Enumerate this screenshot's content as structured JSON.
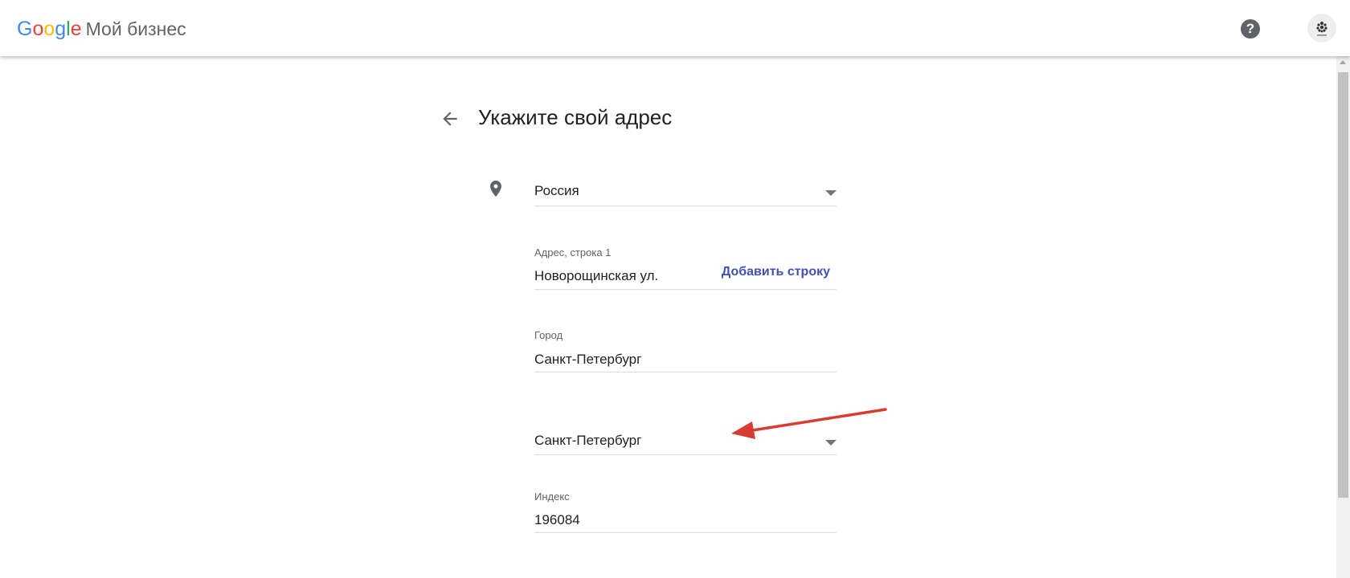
{
  "header": {
    "logo_text": "Google",
    "product_name": "Мой бизнес",
    "help_label": "?"
  },
  "page": {
    "title": "Укажите свой адрес"
  },
  "form": {
    "country": {
      "value": "Россия"
    },
    "address_line1": {
      "label": "Адрес, строка 1",
      "value": "Новорощинская ул.",
      "add_line_label": "Добавить строку"
    },
    "city": {
      "label": "Город",
      "value": "Санкт-Петербург"
    },
    "region": {
      "value": "Санкт-Петербург"
    },
    "postal_code": {
      "label": "Индекс",
      "value": "196084"
    }
  },
  "colors": {
    "google_blue": "#4285F4",
    "google_red": "#EA4335",
    "google_yellow": "#FBBC05",
    "google_green": "#34A853",
    "link_color": "#3F51B5",
    "annotation_arrow": "#D93B30"
  },
  "icons": {
    "back": "arrow-back-icon",
    "location": "location-pin-icon",
    "help": "help-circle-icon",
    "dropdown": "caret-down-icon"
  }
}
